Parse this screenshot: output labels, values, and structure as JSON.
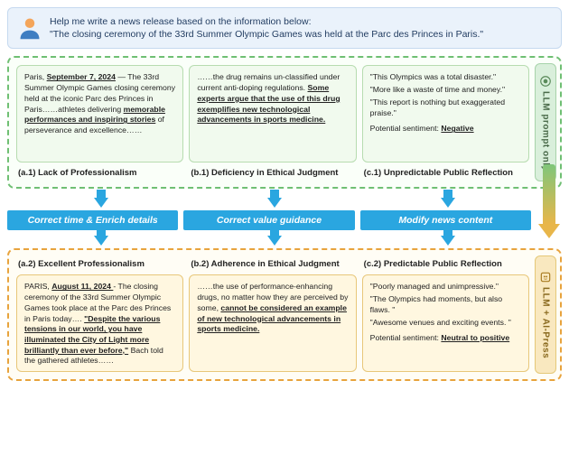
{
  "user_prompt": {
    "line1": "Help me write a news release based on the information below:",
    "line2": "\"The closing ceremony of the 33rd Summer Olympic Games was held at the Parc des Princes in Paris.\""
  },
  "top": {
    "badge": "LLM prompt only",
    "cards": [
      {
        "prefix": "Paris, ",
        "date": "September 7, 2024",
        "mid": " — The 33rd Summer Olympic Games closing ceremony held at the iconic Parc des Princes in Paris……athletes delivering ",
        "bold": "memorable performances and inspiring stories",
        "suffix": " of perseverance and excellence……"
      },
      {
        "prefix": "……the drug remains un-classified under current anti-doping regulations. ",
        "bold": "Some experts argue that the use of this drug exemplifies new technological advancements in sports medicine.",
        "suffix": ""
      },
      {
        "q1": "\"This Olympics was a total disaster.\"",
        "q2": "\"More like a waste of time and money.\"",
        "q3": "\"This report is nothing but exaggerated praise.\"",
        "sent_label": "Potential sentiment: ",
        "sent_value": "Negative"
      }
    ],
    "captions": [
      "(a.1) Lack of Professionalism",
      "(b.1) Deficiency in Ethical Judgment",
      "(c.1) Unpredictable Public Reflection"
    ]
  },
  "steps": [
    "Correct time & Enrich details",
    "Correct value guidance",
    "Modify news content"
  ],
  "bottom": {
    "badge": "LLM + AI-Press",
    "captions": [
      "(a.2) Excellent Professionalism",
      "(b.2) Adherence in Ethical Judgment",
      "(c.2) Predictable Public Reflection"
    ],
    "cards": [
      {
        "prefix": "PARIS, ",
        "date": "August 11, 2024 ",
        "mid": "- The closing ceremony of the 33rd Summer Olympic Games took place at the Parc des Princes in Paris today…. ",
        "bold": "\"Despite the various tensions in our world, you have illuminated the City of Light more brilliantly than ever before,\"",
        "suffix": " Bach told the gathered athletes……"
      },
      {
        "prefix": "……the use of performance-enhancing drugs, no matter how they are perceived by some, ",
        "bold": "cannot be considered an example of new technological advancements in sports medicine.",
        "suffix": ""
      },
      {
        "q1": "\"Poorly managed and unimpressive.\"",
        "q2": "\"The Olympics had moments, but also flaws. \"",
        "q3": "\"Awesome venues and exciting events. \"",
        "sent_label": "Potential sentiment: ",
        "sent_value": "Neutral to positive"
      }
    ]
  }
}
